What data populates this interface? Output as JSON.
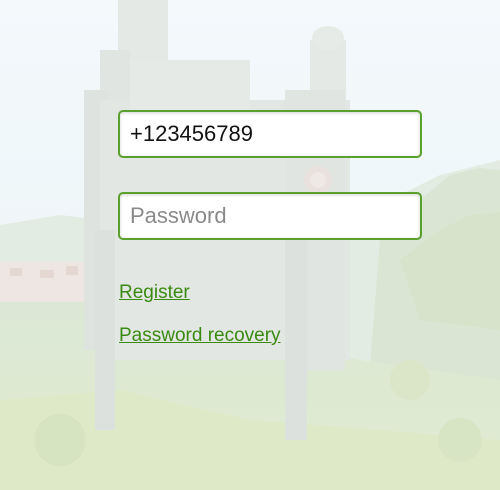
{
  "login": {
    "phone_value": "+123456789",
    "password_placeholder": "Password",
    "register_label": "Register",
    "recovery_label": "Password recovery"
  },
  "colors": {
    "accent": "#5aa02c",
    "link": "#3a8a12"
  }
}
